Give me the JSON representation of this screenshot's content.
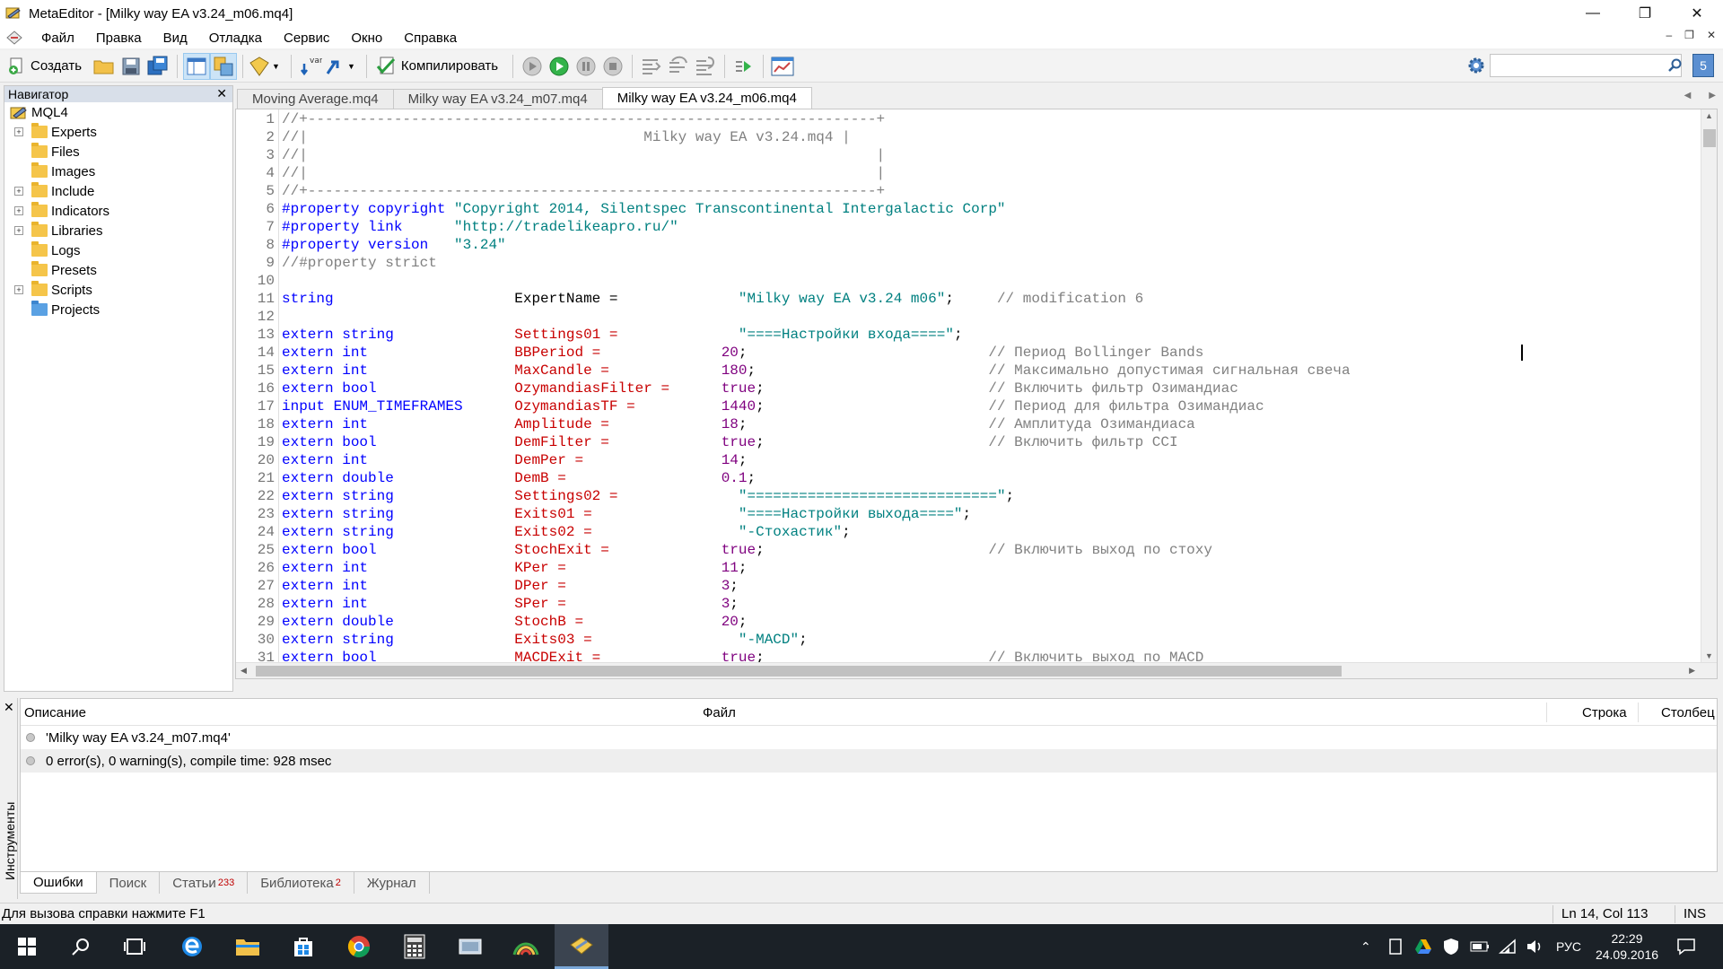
{
  "window": {
    "title": "MetaEditor - [Milky way EA v3.24_m06.mq4]"
  },
  "menu": [
    "Файл",
    "Правка",
    "Вид",
    "Отладка",
    "Сервис",
    "Окно",
    "Справка"
  ],
  "toolbar": {
    "create_label": "Создать",
    "compile_label": "Компилировать",
    "var_label": "var"
  },
  "navigator": {
    "title": "Навигатор",
    "root": "MQL4",
    "items": [
      {
        "label": "Experts",
        "expandable": true
      },
      {
        "label": "Files",
        "expandable": false
      },
      {
        "label": "Images",
        "expandable": false
      },
      {
        "label": "Include",
        "expandable": true
      },
      {
        "label": "Indicators",
        "expandable": true
      },
      {
        "label": "Libraries",
        "expandable": true
      },
      {
        "label": "Logs",
        "expandable": false
      },
      {
        "label": "Presets",
        "expandable": false
      },
      {
        "label": "Scripts",
        "expandable": true
      },
      {
        "label": "Projects",
        "expandable": false
      }
    ]
  },
  "tabs": [
    "Moving Average.mq4",
    "Milky way EA v3.24_m07.mq4",
    "Milky way EA v3.24_m06.mq4"
  ],
  "active_tab": 2,
  "code_lines": [
    [
      [
        "c-cmt",
        "//+------------------------------------------------------------------+"
      ]
    ],
    [
      [
        "c-cmt",
        "//|                                       Milky way EA v3.24.mq4 |"
      ]
    ],
    [
      [
        "c-cmt",
        "//|                                                                  |"
      ]
    ],
    [
      [
        "c-cmt",
        "//|                                                                  |"
      ]
    ],
    [
      [
        "c-cmt",
        "//+------------------------------------------------------------------+"
      ]
    ],
    [
      [
        "c-kw",
        "#property copyright "
      ],
      [
        "c-str",
        "\"Copyright 2014, Silentspec Transcontinental Intergalactic Corp\""
      ]
    ],
    [
      [
        "c-kw",
        "#property link      "
      ],
      [
        "c-str",
        "\"http://tradelikeapro.ru/\""
      ]
    ],
    [
      [
        "c-kw",
        "#property version   "
      ],
      [
        "c-str",
        "\"3.24\""
      ]
    ],
    [
      [
        "c-cmt",
        "//#property strict"
      ]
    ],
    [],
    [
      [
        "c-kw",
        "string                     "
      ],
      [
        "c-plain",
        "ExpertName =              "
      ],
      [
        "c-str",
        "\"Milky way EA v3.24 m06\""
      ],
      [
        "c-plain",
        ";     "
      ],
      [
        "c-cmt",
        "// modification 6"
      ]
    ],
    [],
    [
      [
        "c-kw",
        "extern string              "
      ],
      [
        "c-var",
        "Settings01 =              "
      ],
      [
        "c-str",
        "\"====Настройки входа====\""
      ],
      [
        "c-plain",
        ";"
      ]
    ],
    [
      [
        "c-kw",
        "extern int                 "
      ],
      [
        "c-var",
        "BBPeriod =              "
      ],
      [
        "c-num",
        "20"
      ],
      [
        "c-plain",
        ";                            "
      ],
      [
        "c-cmt",
        "// Период Bollinger Bands"
      ]
    ],
    [
      [
        "c-kw",
        "extern int                 "
      ],
      [
        "c-var",
        "MaxCandle =             "
      ],
      [
        "c-num",
        "180"
      ],
      [
        "c-plain",
        ";                           "
      ],
      [
        "c-cmt",
        "// Максимально допустимая сигнальная свеча"
      ]
    ],
    [
      [
        "c-kw",
        "extern bool                "
      ],
      [
        "c-var",
        "OzymandiasFilter =      "
      ],
      [
        "c-num",
        "true"
      ],
      [
        "c-plain",
        ";                          "
      ],
      [
        "c-cmt",
        "// Включить фильтр Озимандиас"
      ]
    ],
    [
      [
        "c-kw",
        "input ENUM_TIMEFRAMES      "
      ],
      [
        "c-var",
        "OzymandiasTF =          "
      ],
      [
        "c-num",
        "1440"
      ],
      [
        "c-plain",
        ";                          "
      ],
      [
        "c-cmt",
        "// Период для фильтра Озимандиас"
      ]
    ],
    [
      [
        "c-kw",
        "extern int                 "
      ],
      [
        "c-var",
        "Amplitude =             "
      ],
      [
        "c-num",
        "18"
      ],
      [
        "c-plain",
        ";                            "
      ],
      [
        "c-cmt",
        "// Амплитуда Озимандиаса"
      ]
    ],
    [
      [
        "c-kw",
        "extern bool                "
      ],
      [
        "c-var",
        "DemFilter =             "
      ],
      [
        "c-num",
        "true"
      ],
      [
        "c-plain",
        ";                          "
      ],
      [
        "c-cmt",
        "// Включить фильтр CCI"
      ]
    ],
    [
      [
        "c-kw",
        "extern int                 "
      ],
      [
        "c-var",
        "DemPer =                "
      ],
      [
        "c-num",
        "14"
      ],
      [
        "c-plain",
        ";"
      ]
    ],
    [
      [
        "c-kw",
        "extern double              "
      ],
      [
        "c-var",
        "DemB =                  "
      ],
      [
        "c-num",
        "0.1"
      ],
      [
        "c-plain",
        ";"
      ]
    ],
    [
      [
        "c-kw",
        "extern string              "
      ],
      [
        "c-var",
        "Settings02 =              "
      ],
      [
        "c-str",
        "\"=============================\""
      ],
      [
        "c-plain",
        ";"
      ]
    ],
    [
      [
        "c-kw",
        "extern string              "
      ],
      [
        "c-var",
        "Exits01 =                 "
      ],
      [
        "c-str",
        "\"====Настройки выхода====\""
      ],
      [
        "c-plain",
        ";"
      ]
    ],
    [
      [
        "c-kw",
        "extern string              "
      ],
      [
        "c-var",
        "Exits02 =                 "
      ],
      [
        "c-str",
        "\"-Стохастик\""
      ],
      [
        "c-plain",
        ";"
      ]
    ],
    [
      [
        "c-kw",
        "extern bool                "
      ],
      [
        "c-var",
        "StochExit =             "
      ],
      [
        "c-num",
        "true"
      ],
      [
        "c-plain",
        ";                          "
      ],
      [
        "c-cmt",
        "// Включить выход по стоху"
      ]
    ],
    [
      [
        "c-kw",
        "extern int                 "
      ],
      [
        "c-var",
        "KPer =                  "
      ],
      [
        "c-num",
        "11"
      ],
      [
        "c-plain",
        ";"
      ]
    ],
    [
      [
        "c-kw",
        "extern int                 "
      ],
      [
        "c-var",
        "DPer =                  "
      ],
      [
        "c-num",
        "3"
      ],
      [
        "c-plain",
        ";"
      ]
    ],
    [
      [
        "c-kw",
        "extern int                 "
      ],
      [
        "c-var",
        "SPer =                  "
      ],
      [
        "c-num",
        "3"
      ],
      [
        "c-plain",
        ";"
      ]
    ],
    [
      [
        "c-kw",
        "extern double              "
      ],
      [
        "c-var",
        "StochB =                "
      ],
      [
        "c-num",
        "20"
      ],
      [
        "c-plain",
        ";"
      ]
    ],
    [
      [
        "c-kw",
        "extern string              "
      ],
      [
        "c-var",
        "Exits03 =                 "
      ],
      [
        "c-str",
        "\"-MACD\""
      ],
      [
        "c-plain",
        ";"
      ]
    ],
    [
      [
        "c-kw",
        "extern bool                "
      ],
      [
        "c-var",
        "MACDExit =              "
      ],
      [
        "c-num",
        "true"
      ],
      [
        "c-plain",
        ";                          "
      ],
      [
        "c-cmt",
        "// Включить выход по MACD"
      ]
    ]
  ],
  "toolbox": {
    "side_label": "Инструменты",
    "columns": [
      "Описание",
      "Файл",
      "Строка",
      "Столбец"
    ],
    "messages": [
      "'Milky way EA v3.24_m07.mq4'",
      "0 error(s), 0 warning(s), compile time: 928 msec"
    ],
    "tabs": [
      {
        "label": "Ошибки",
        "badge": ""
      },
      {
        "label": "Поиск",
        "badge": ""
      },
      {
        "label": "Статьи",
        "badge": "233"
      },
      {
        "label": "Библиотека",
        "badge": "2"
      },
      {
        "label": "Журнал",
        "badge": ""
      }
    ]
  },
  "status": {
    "hint": "Для вызова справки нажмите F1",
    "position": "Ln 14, Col 113",
    "mode": "INS"
  },
  "taskbar": {
    "lang": "РУС",
    "time": "22:29",
    "date": "24.09.2016"
  }
}
